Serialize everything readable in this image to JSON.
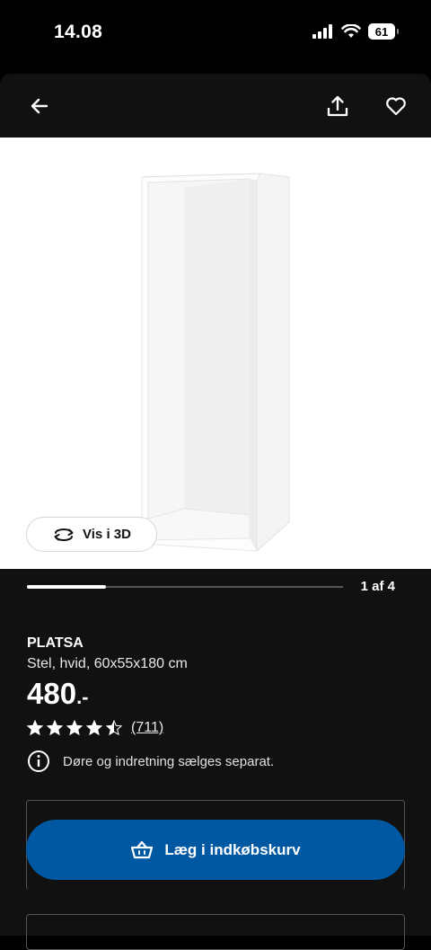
{
  "status_bar": {
    "time": "14.08",
    "battery": "61"
  },
  "header": {
    "back_icon": "arrow-left-icon",
    "share_icon": "share-icon",
    "favorite_icon": "heart-icon"
  },
  "hero": {
    "view_3d_label": "Vis i 3D",
    "view_3d_icon": "rotate-3d-icon"
  },
  "gallery": {
    "current": 1,
    "total": 4,
    "indicator": "1 af 4",
    "progress": 0.25
  },
  "product": {
    "name": "PLATSA",
    "description": "Stel, hvid, 60x55x180 cm",
    "price": "480",
    "price_suffix": ".-",
    "rating": 4.5,
    "review_count": "(711)",
    "notice": "Døre og indretning sælges separat."
  },
  "actions": {
    "add_to_cart": "Læg i indkøbskurv"
  },
  "colors": {
    "background": "#111111",
    "accent": "#0058a3",
    "text": "#ffffff"
  }
}
